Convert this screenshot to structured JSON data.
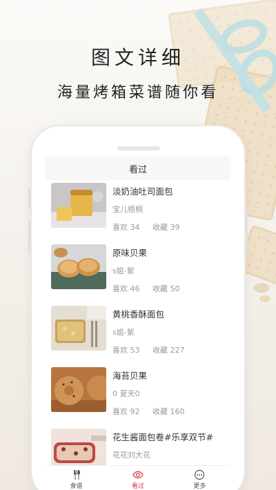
{
  "promo": {
    "title": "图文详细",
    "subtitle": "海量烤箱菜谱随你看"
  },
  "screen": {
    "title": "看过"
  },
  "items": [
    {
      "title": "淡奶油吐司面包",
      "author": "宝儿梧桐",
      "likes": "喜欢 34",
      "favorites": "收藏 39"
    },
    {
      "title": "原味贝果",
      "author": "s姐-絮",
      "likes": "喜欢 46",
      "favorites": "收藏 50"
    },
    {
      "title": "黄桃香酥面包",
      "author": "s姐-絮",
      "likes": "喜欢 53",
      "favorites": "收藏 227"
    },
    {
      "title": "海苔贝果",
      "author": "0 夏天0",
      "likes": "喜欢 92",
      "favorites": "收藏 160"
    },
    {
      "title": "花生酱面包卷#乐享双节#",
      "author": "花花刘大花"
    }
  ],
  "tabs": [
    {
      "label": "食谱",
      "icon": "utensils-icon"
    },
    {
      "label": "看过",
      "icon": "eye-icon"
    },
    {
      "label": "更多",
      "icon": "more-icon"
    }
  ],
  "colors": {
    "accent": "#d63a3a"
  }
}
